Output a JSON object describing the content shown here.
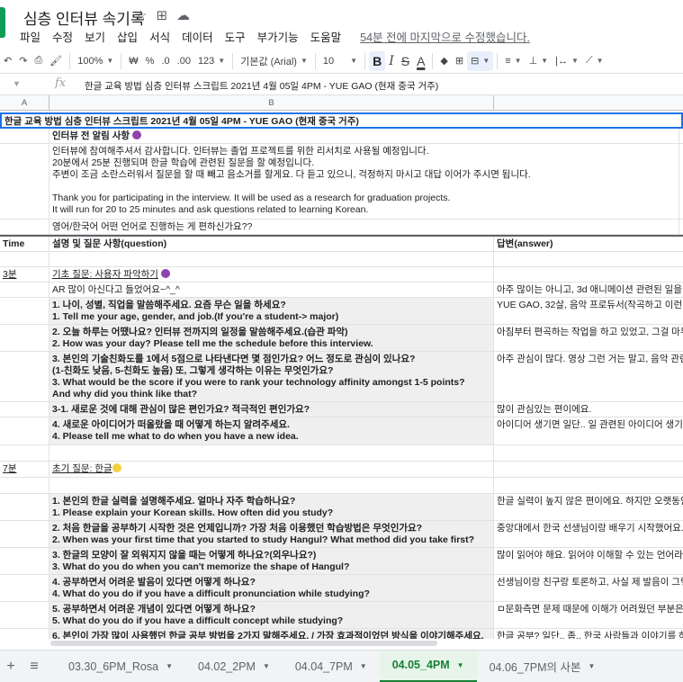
{
  "app": {
    "title": "심층 인터뷰 속기록",
    "icons": [
      "star-icon",
      "move-to-folder-icon",
      "cloud-status-icon"
    ],
    "accent_color": "#188038"
  },
  "menu": {
    "items": [
      "파일",
      "수정",
      "보기",
      "삽입",
      "서식",
      "데이터",
      "도구",
      "부가기능",
      "도움말"
    ],
    "last_edit": "54분 전에 마지막으로 수정했습니다."
  },
  "toolbar": {
    "zoom": "100%",
    "currency": "₩",
    "percent": "%",
    "dec_decrease": ".0",
    "dec_increase": ".00",
    "format_more": "123",
    "font": "기본값 (Arial)",
    "font_size": "10",
    "bold": "B",
    "italic": "I",
    "strike": "S",
    "text_color": "A"
  },
  "formula_bar": {
    "fx": "fx",
    "value": "한글 교육 방법 심층 인터뷰 스크립트 2021년 4월 05일 4PM - YUE GAO (현재 중국 거주)"
  },
  "columns": [
    "A",
    "B"
  ],
  "rows": {
    "r1": "한글 교육 방법 심층 인터뷰 스크립트 2021년 4월 05일 4PM - YUE GAO (현재 중국 거주)",
    "r2": "인터뷰 전 알림 사항",
    "r3_l1": "인터뷰에 참여해주셔서 감사합니다. 인터뷰는 졸업 프로젝트를 위한 리서치로 사용될 예정입니다.",
    "r3_l2": "20분에서 25분 진행되며 한글 학습에 관련된 질문을 할 예정입니다.",
    "r3_l3": "주변이 조금 소란스러워서 질문을 할 때 빼고 음소거를 할게요. 다 듣고 있으니, 걱정하지 마시고 대답 이어가 주시면 됩니다.",
    "r3_l4": "Thank you for participating in the interview. It will be used as a research for graduation projects.",
    "r3_l5": "It will run for 20 to 25 minutes and ask questions related to learning Korean.",
    "r4": "영어/한국어 어떤 언어로 진행하는 게 편하신가요??",
    "header_time": "Time",
    "header_question": "설명 및 질문 사항(question)",
    "header_answer": "답변(answer)",
    "s1_time": "3분",
    "s1_title": "기초 질문: 사용자 파악하기",
    "q0": "AR 많이 아신다고 들었어요~^_^",
    "a0": "아주 많이는 아니고, 3d 애니메이션 관련된 일을",
    "q1_l1": "1. 나이, 성별, 직업을 말씀해주세요. 요즘 무슨 일을 하세요?",
    "q1_l2": "1. Tell me your age, gender, and job.(If you're a student-> major)",
    "a1": "YUE GAO, 32살, 음악 프로듀서(작곡하고 이런",
    "q2_l1": "2. 오늘 하루는 어땠나요? 인터뷰 전까지의 일정을 말씀해주세요.(습관 파악)",
    "q2_l2": "2. How was your day? Please tell me the schedule before this interview.",
    "a2": "아침부터 편곡하는 작업을 하고 있었고, 그걸 마무",
    "q3_l1": "3. 본인의 기술친화도를 1에서 5점으로 나타낸다면 몇 점인가요? 어느 정도로 관심이 있나요?",
    "q3_l2": "(1-친화도 낮음, 5-친화도 높음) 또, 그렇게 생각하는 이유는 무엇인가요?",
    "q3_l3": "3. What would be the score if you were to rank your technology affinity amongst 1-5 points?",
    "q3_l4": "And why did you think like that?",
    "a3": "아주 관심이 많다. 영상 그런 거는 말고, 음악 관련",
    "q31": "3-1. 새로운 것에 대해 관심이 많은 편인가요? 적극적인 편인가요?",
    "a31": "많이 관심있는 편이에요.",
    "q4_l1": "4. 새로운 아이디어가 떠올랐을 때 어떻게 하는지 알려주세요.",
    "q4_l2": "4. Please tell me what to do when you have a new idea.",
    "a4": "아이디어 생기면 일단.. 일 관련된 아이디어 생기",
    "s2_time": "7분",
    "s2_title": "초기 질문: 한글",
    "k1_l1": "1. 본인의 한글 실력을 설명해주세요. 얼마나 자주 학습하나요?",
    "k1_l2": "1. Please explain your Korean skills. How often did you study?",
    "ka1": "한글 실력이 높지 않은 편이에요. 하지만 오랫동안",
    "k2_l1": "2. 처음 한글을 공부하기 시작한 것은 언제입니까? 가장 처음 이용했던 학습방법은 무엇인가요?",
    "k2_l2": "2. When was your first time that you started to study Hangul? What method did you take first?",
    "ka2": "중앙대에서 한국 선생님이랑 배우기 시작했어요.",
    "k3_l1": "3. 한글의 모양이 잘 외워지지 않을 때는 어떻게 하나요?(외우나요?)",
    "k3_l2": "3. What do you do when you can't memorize the shape of Hangul?",
    "ka3": "많이 읽어야 해요. 읽어야 이해할 수 있는 언어라",
    "k4_l1": "4. 공부하면서 어려운 발음이 있다면 어떻게 하나요?",
    "k4_l2": "4. What do you do if you have a difficult pronunciation while studying?",
    "ka4": "선생님이랑 친구랑 토론하고, 사실 제 발음이 그렇",
    "k5_l1": "5. 공부하면서 어려운 개념이 있다면 어떻게 하나요?",
    "k5_l2": "5. What do you do if you have a difficult concept while studying?",
    "ka5": "ㅁ문화측면 문제 때문에 이해가 어려웠던 부분은",
    "k6_l1": "6. 본인이 가장 많이 사용했던 한글 공부 방법을 2가지 말해주세요. / 가장 효과적이었던 방식을 이야기해주세요.",
    "ka6": "한글 공부? 일단.. 좀.. 한국 사람들과 이야기를 하"
  },
  "tabs": {
    "add": "+",
    "list": "≡",
    "t1": "03.30_6PM_Rosa",
    "t2": "04.02_2PM",
    "t3": "04.04_7PM",
    "t4": "04.05_4PM",
    "t5": "04.06_7PM의 사본"
  }
}
